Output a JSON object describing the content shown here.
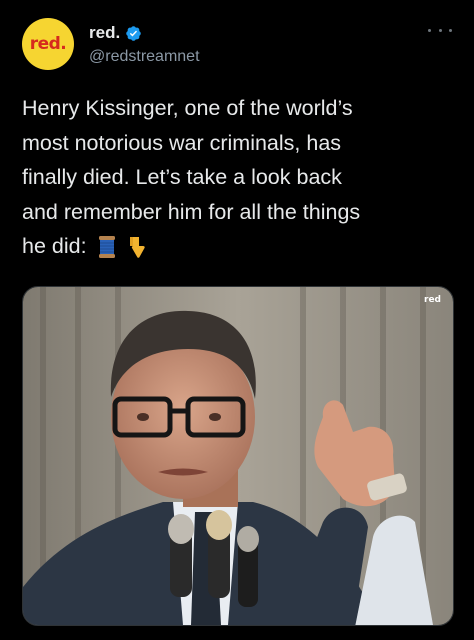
{
  "author": {
    "avatar_text": "red.",
    "display_name": "red.",
    "handle": "@redstreamnet",
    "verified_icon": "verified-badge-icon"
  },
  "tweet": {
    "lines": [
      "Henry Kissinger, one of the world’s",
      "most notorious war criminals, has",
      "finally died. Let’s take a look back",
      "and remember him for all the things",
      "he did:"
    ],
    "emojis": [
      "spool-of-thread-icon",
      "backhand-index-pointing-down-icon"
    ]
  },
  "media": {
    "watermark": "red"
  },
  "colors": {
    "background": "#000000",
    "text": "#e7e9ea",
    "secondary_text": "#8b98a5",
    "verified": "#1d9bf0",
    "avatar_bg": "#f6d531",
    "avatar_text": "#d62a1d"
  }
}
